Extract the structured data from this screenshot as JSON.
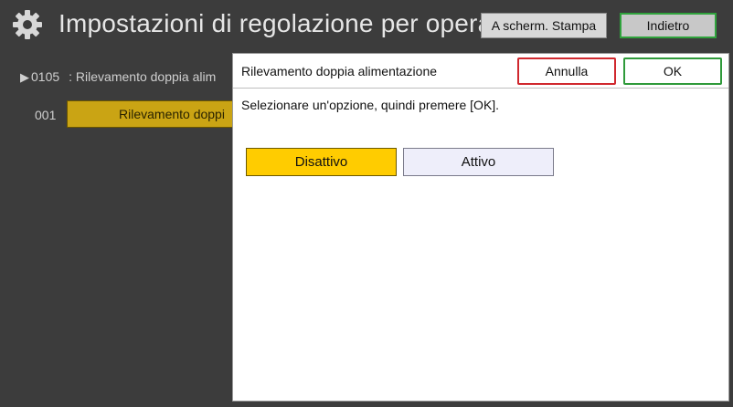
{
  "header": {
    "title": "Impostazioni di regolazione per operatori",
    "print_screen_label": "A scherm. Stampa",
    "back_label": "Indietro",
    "icon": "gear-icon"
  },
  "background": {
    "setting_code": "0105",
    "setting_name": ": Rilevamento doppia alim",
    "item_number": "001",
    "item_label": "Rilevamento doppi"
  },
  "dialog": {
    "title": "Rilevamento doppia alimentazione",
    "cancel_label": "Annulla",
    "ok_label": "OK",
    "prompt": "Selezionare un'opzione, quindi premere [OK].",
    "options": [
      {
        "label": "Disattivo",
        "selected": true
      },
      {
        "label": "Attivo",
        "selected": false
      }
    ]
  },
  "colors": {
    "selected": "#ffcc00",
    "cancel_border": "#d0282e",
    "ok_border": "#2f9a3a"
  }
}
